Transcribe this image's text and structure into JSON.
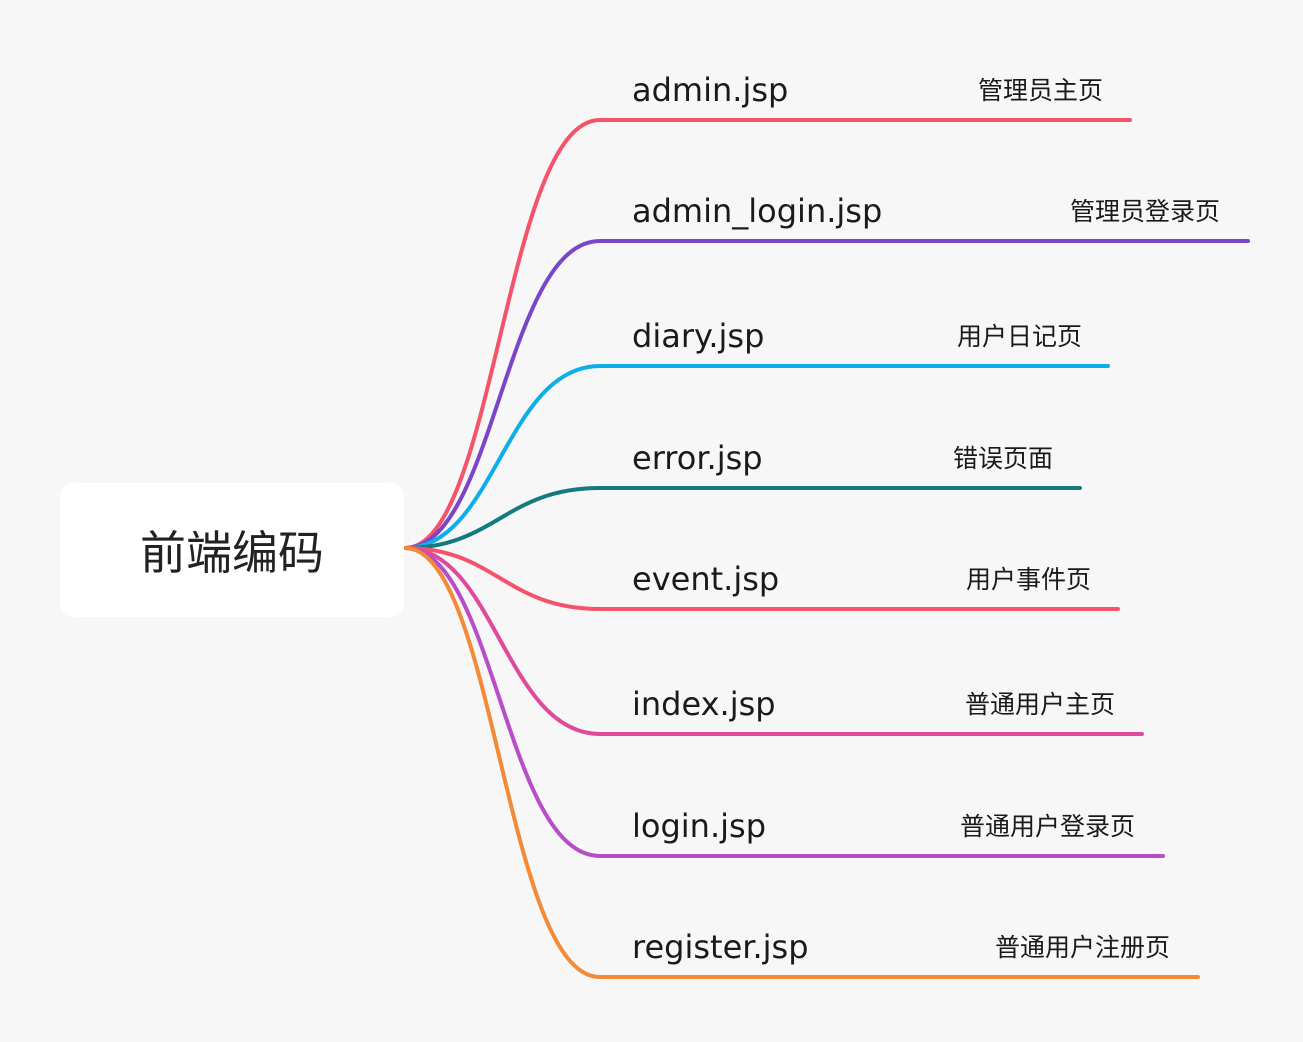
{
  "root": {
    "label": "前端编码"
  },
  "branches": [
    {
      "file": "admin.jsp",
      "desc": "管理员主页",
      "color": "#f4536a"
    },
    {
      "file": "admin_login.jsp",
      "desc": "管理员登录页",
      "color": "#7b45c9"
    },
    {
      "file": "diary.jsp",
      "desc": "用户日记页",
      "color": "#0eaeea"
    },
    {
      "file": "error.jsp",
      "desc": "错误页面",
      "color": "#137a7e"
    },
    {
      "file": "event.jsp",
      "desc": "用户事件页",
      "color": "#f4536a"
    },
    {
      "file": "index.jsp",
      "desc": "普通用户主页",
      "color": "#e04a9c"
    },
    {
      "file": "login.jsp",
      "desc": "普通用户登录页",
      "color": "#b94cc9"
    },
    {
      "file": "register.jsp",
      "desc": "普通用户注册页",
      "color": "#f48a35"
    }
  ]
}
